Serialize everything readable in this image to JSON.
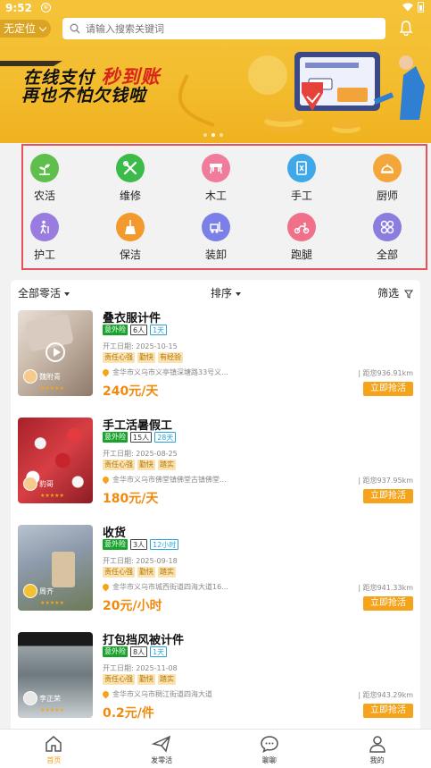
{
  "status": {
    "time": "9:52",
    "sim_icon": "④"
  },
  "header": {
    "location": "无定位",
    "search_placeholder": "请输入搜索关键词"
  },
  "banner": {
    "line1_a": "在线支付",
    "line1_b": "秒到账",
    "line2": "再也不怕欠钱啦",
    "slides": 3,
    "active_slide": 2
  },
  "categories": [
    {
      "label": "农活",
      "icon": "sprout-icon",
      "color": "#5fbf4c"
    },
    {
      "label": "维修",
      "icon": "tools-icon",
      "color": "#3dbb4a"
    },
    {
      "label": "木工",
      "icon": "table-icon",
      "color": "#f07b9a"
    },
    {
      "label": "手工",
      "icon": "card-icon",
      "color": "#3fa8e8"
    },
    {
      "label": "厨师",
      "icon": "cloche-icon",
      "color": "#f4a63a"
    },
    {
      "label": "护工",
      "icon": "walker-icon",
      "color": "#9a7be0"
    },
    {
      "label": "保洁",
      "icon": "broom-icon",
      "color": "#f39a2e"
    },
    {
      "label": "装卸",
      "icon": "forklift-icon",
      "color": "#7b7fe8"
    },
    {
      "label": "跑腿",
      "icon": "scooter-icon",
      "color": "#f0708a"
    },
    {
      "label": "全部",
      "icon": "grid-icon",
      "color": "#8a7de0"
    }
  ],
  "filters": {
    "type": "全部零活",
    "sort": "排序",
    "filter": "筛选"
  },
  "jobs": [
    {
      "title": "叠衣服计件",
      "insurance": "意外险",
      "people": "6人",
      "days": "1天",
      "date": "开工日期:  2025-10-15",
      "tags": [
        "责任心强",
        "勤快",
        "有经验"
      ],
      "address": "金华市义乌市义亭镇深塘路33号义...",
      "distance": "| 距您936.91km",
      "price": "240元/天",
      "user": "魏附青",
      "has_video": true
    },
    {
      "title": "手工活暑假工",
      "insurance": "意外险",
      "people": "15人",
      "days": "28天",
      "date": "开工日期:  2025-08-25",
      "tags": [
        "责任心强",
        "勤快",
        "踏实"
      ],
      "address": "金华市义乌市佛堂镇佛堂古镇佛堂...",
      "distance": "| 距您937.95km",
      "price": "180元/天",
      "user": "豹哥",
      "has_video": false
    },
    {
      "title": "收货",
      "insurance": "意外险",
      "people": "3人",
      "days": "12小时",
      "date": "开工日期:  2025-09-18",
      "tags": [
        "责任心强",
        "勤快",
        "踏实"
      ],
      "address": "金华市义乌市城西街道四海大道16...",
      "distance": "| 距您941.33km",
      "price": "20元/小时",
      "user": "周齐",
      "has_video": false
    },
    {
      "title": "打包挡风被计件",
      "insurance": "意外险",
      "people": "8人",
      "days": "1天",
      "date": "开工日期:  2025-11-08",
      "tags": [
        "责任心强",
        "勤快",
        "踏实"
      ],
      "address": "金华市义乌市稠江街道四海大道",
      "distance": "| 距您943.29km",
      "price": "0.2元/件",
      "user": "李正荣",
      "has_video": false
    }
  ],
  "grab_label": "立即抢活",
  "tabs": [
    {
      "label": "首页",
      "icon": "home-icon",
      "active": true
    },
    {
      "label": "发零活",
      "icon": "send-icon",
      "active": false
    },
    {
      "label": "聊聊",
      "icon": "chat-icon",
      "active": false
    },
    {
      "label": "我的",
      "icon": "user-icon",
      "active": false
    }
  ],
  "colors": {
    "accent": "#f5a31a",
    "highlight_border": "#e8505b",
    "insurance": "#17a32c"
  }
}
